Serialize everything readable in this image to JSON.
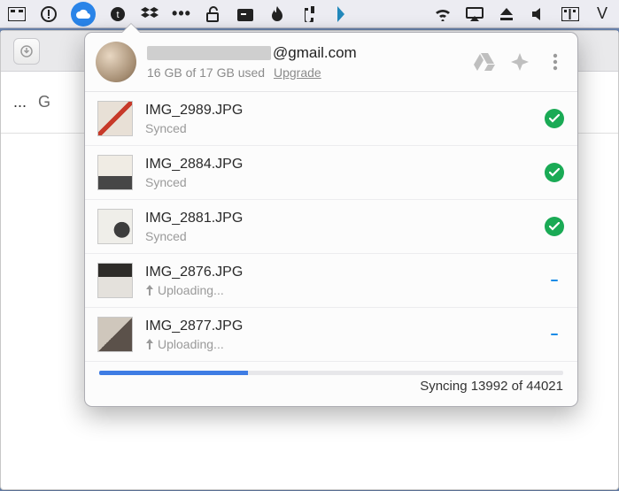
{
  "account": {
    "email_domain": "@gmail.com",
    "storage_line": "16 GB of 17 GB used",
    "upgrade_label": "Upgrade"
  },
  "files": [
    {
      "name": "IMG_2989.JPG",
      "status": "Synced",
      "state": "synced"
    },
    {
      "name": "IMG_2884.JPG",
      "status": "Synced",
      "state": "synced"
    },
    {
      "name": "IMG_2881.JPG",
      "status": "Synced",
      "state": "synced"
    },
    {
      "name": "IMG_2876.JPG",
      "status": "Uploading...",
      "state": "uploading"
    },
    {
      "name": "IMG_2877.JPG",
      "status": "Uploading...",
      "state": "uploading"
    }
  ],
  "sync": {
    "done": 13992,
    "total": 44021,
    "text": "Syncing 13992 of 44021",
    "progress_percent": 32
  },
  "bg_window": {
    "initial": "G"
  }
}
